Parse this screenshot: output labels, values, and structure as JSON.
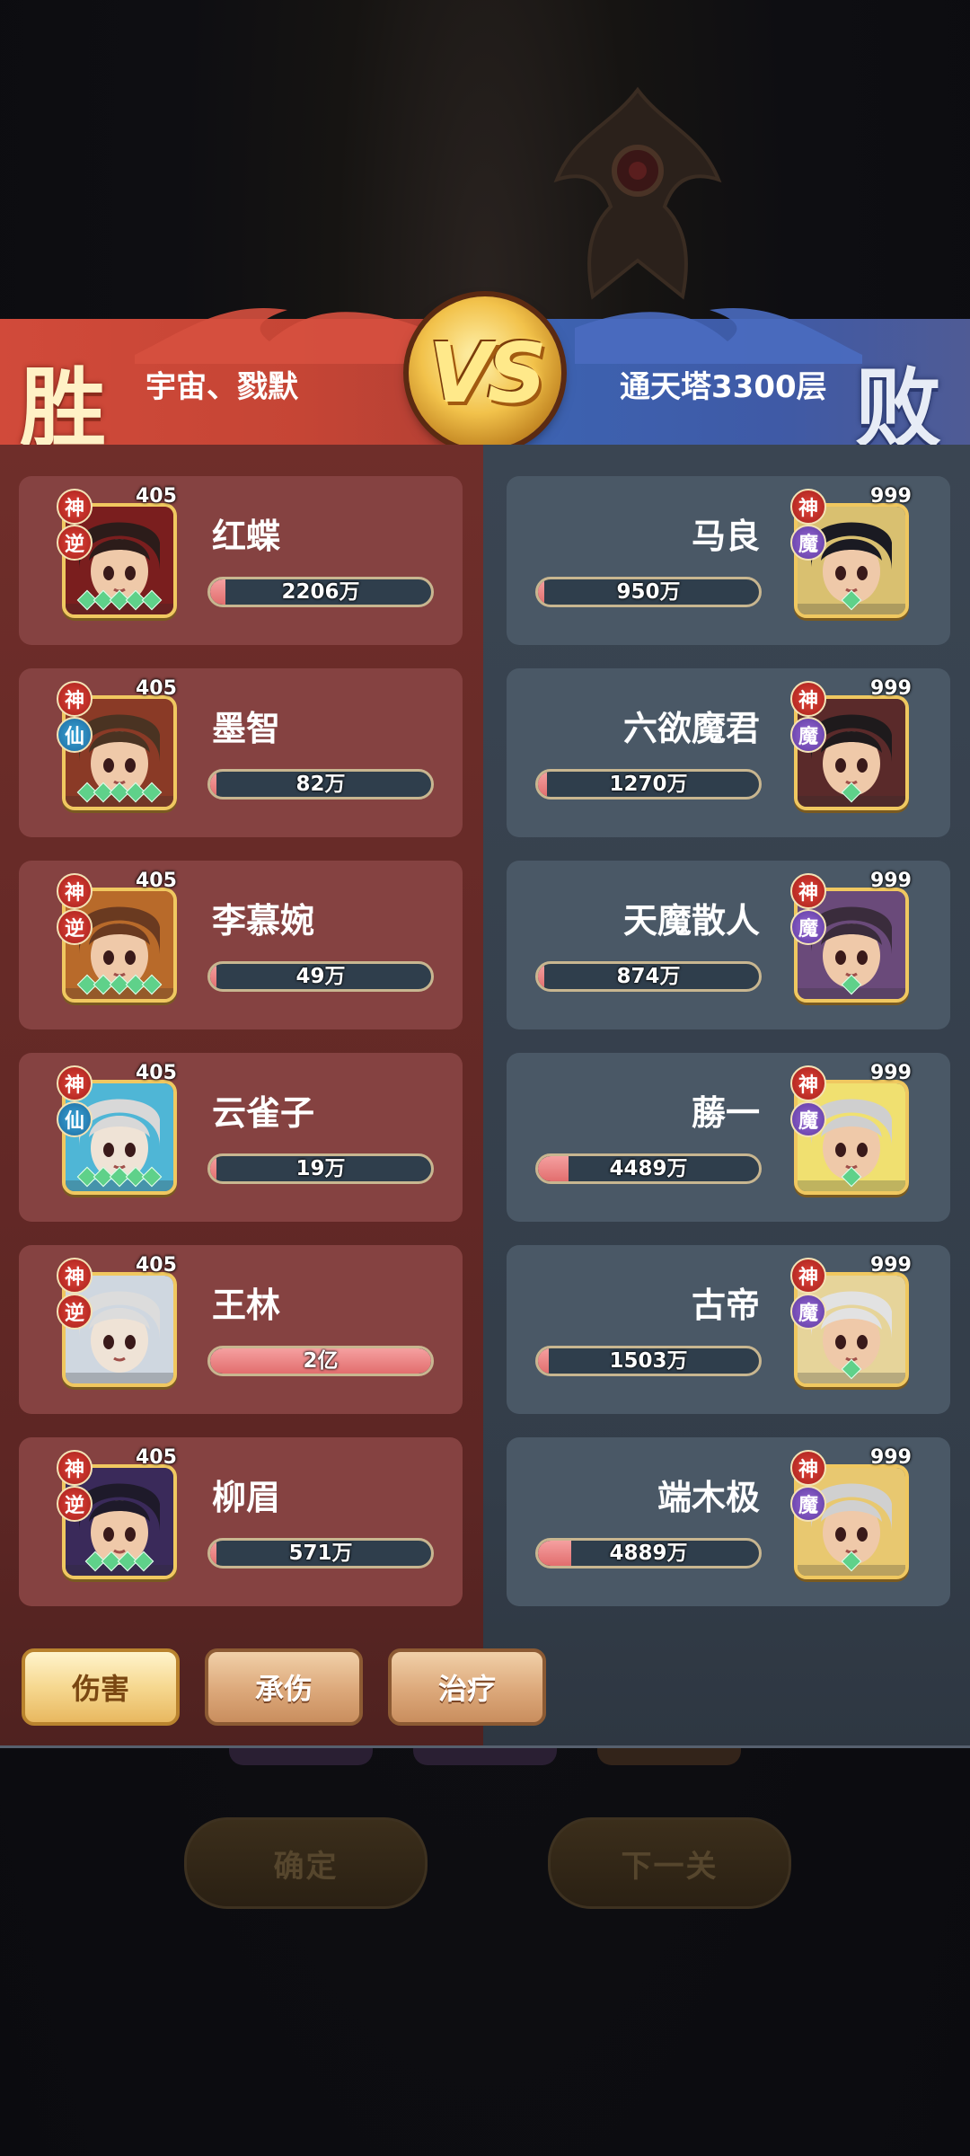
{
  "header": {
    "win_label": "胜",
    "lose_label": "败",
    "left_team": "宇宙、戮默",
    "right_team": "通天塔3300层",
    "vs_label": "VS"
  },
  "left_units": [
    {
      "name": "红蝶",
      "level": "405",
      "rank_badge": "神",
      "faction_badge": "逆",
      "faction": "ni",
      "value": "2206万",
      "bar_fill": 0.07,
      "stars": 5
    },
    {
      "name": "墨智",
      "level": "405",
      "rank_badge": "神",
      "faction_badge": "仙",
      "faction": "xian",
      "value": "82万",
      "bar_fill": 0.0,
      "stars": 5
    },
    {
      "name": "李慕婉",
      "level": "405",
      "rank_badge": "神",
      "faction_badge": "逆",
      "faction": "ni",
      "value": "49万",
      "bar_fill": 0.0,
      "stars": 5
    },
    {
      "name": "云雀子",
      "level": "405",
      "rank_badge": "神",
      "faction_badge": "仙",
      "faction": "xian",
      "value": "19万",
      "bar_fill": 0.0,
      "stars": 5
    },
    {
      "name": "王林",
      "level": "405",
      "rank_badge": "神",
      "faction_badge": "逆",
      "faction": "ni",
      "value": "2亿",
      "bar_fill": 1.0,
      "stars": 0
    },
    {
      "name": "柳眉",
      "level": "405",
      "rank_badge": "神",
      "faction_badge": "逆",
      "faction": "ni",
      "value": "571万",
      "bar_fill": 0.0,
      "stars": 4
    }
  ],
  "right_units": [
    {
      "name": "马良",
      "level": "999",
      "rank_badge": "神",
      "faction_badge": "魔",
      "faction": "mo",
      "value": "950万",
      "bar_fill": 0.03
    },
    {
      "name": "六欲魔君",
      "level": "999",
      "rank_badge": "神",
      "faction_badge": "魔",
      "faction": "mo",
      "value": "1270万",
      "bar_fill": 0.04
    },
    {
      "name": "天魔散人",
      "level": "999",
      "rank_badge": "神",
      "faction_badge": "魔",
      "faction": "mo",
      "value": "874万",
      "bar_fill": 0.03
    },
    {
      "name": "蕂一",
      "level": "999",
      "rank_badge": "神",
      "faction_badge": "魔",
      "faction": "mo",
      "value": "4489万",
      "bar_fill": 0.14
    },
    {
      "name": "古帝",
      "level": "999",
      "rank_badge": "神",
      "faction_badge": "魔",
      "faction": "mo",
      "value": "1503万",
      "bar_fill": 0.05
    },
    {
      "name": "端木极",
      "level": "999",
      "rank_badge": "神",
      "faction_badge": "魔",
      "faction": "mo",
      "value": "4889万",
      "bar_fill": 0.15
    }
  ],
  "tabs": [
    {
      "label": "伤害",
      "active": true
    },
    {
      "label": "承伤",
      "active": false
    },
    {
      "label": "治疗",
      "active": false
    }
  ],
  "background_buttons": {
    "confirm": "确定",
    "next_level": "下一关"
  },
  "colors": {
    "win_red": "#c54535",
    "lose_blue": "#3f5aa6",
    "bar_fill": "#e26e6e",
    "gold": "#f0c860"
  }
}
